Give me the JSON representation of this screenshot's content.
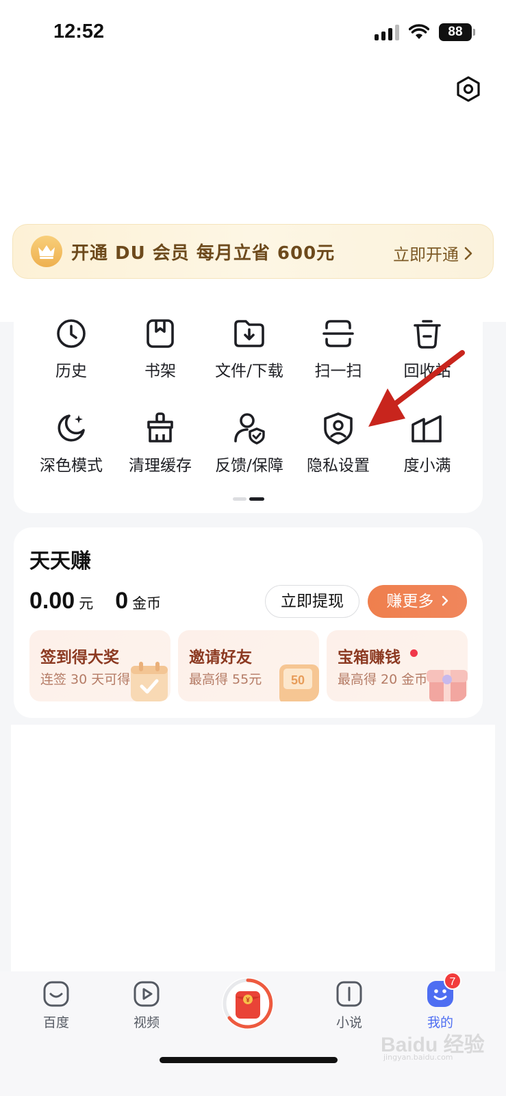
{
  "status_bar": {
    "time": "12:52",
    "battery": "88"
  },
  "vip": {
    "text": "开通 DU 会员 每月立省 600元",
    "action": "立即开通"
  },
  "tools": [
    {
      "label": "历史",
      "icon": "clock-icon"
    },
    {
      "label": "书架",
      "icon": "bookshelf-icon"
    },
    {
      "label": "文件/下载",
      "icon": "folder-download-icon"
    },
    {
      "label": "扫一扫",
      "icon": "scan-icon"
    },
    {
      "label": "回收站",
      "icon": "trash-icon"
    },
    {
      "label": "深色模式",
      "icon": "moon-icon"
    },
    {
      "label": "清理缓存",
      "icon": "clean-icon"
    },
    {
      "label": "反馈/保障",
      "icon": "user-shield-icon"
    },
    {
      "label": "隐私设置",
      "icon": "privacy-shield-icon"
    },
    {
      "label": "度小满",
      "icon": "duxiaoman-icon"
    }
  ],
  "earn": {
    "title": "天天赚",
    "cash_value": "0.00",
    "cash_unit": "元",
    "coin_value": "0",
    "coin_unit": "金币",
    "withdraw": "立即提现",
    "earn_more": "赚更多",
    "tasks": [
      {
        "title": "签到得大奖",
        "subtitle": "连签 30 天可得"
      },
      {
        "title": "邀请好友",
        "subtitle": "最高得 55元",
        "badge": "50"
      },
      {
        "title": "宝箱赚钱",
        "subtitle": "最高得 20 金币"
      }
    ]
  },
  "tabbar": {
    "items": [
      {
        "label": "百度"
      },
      {
        "label": "视频"
      },
      {
        "label": "小说"
      },
      {
        "label": "我的"
      }
    ],
    "badge": "7",
    "center_glyph": "¥"
  },
  "watermark": {
    "brand": "Baidu 经验",
    "url": "jingyan.baidu.com"
  },
  "colors": {
    "accent": "#4e6ef2",
    "orange": "#ef7f4d",
    "annotation": "#c8251d"
  }
}
